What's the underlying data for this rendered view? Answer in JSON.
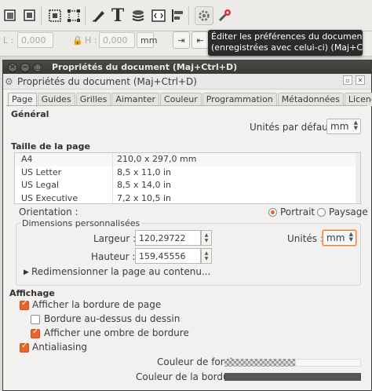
{
  "tooltip": {
    "line1": "Éditer les préférences du document",
    "line2": "(enregistrées avec celui-ci) (Maj+Ctrl+D)"
  },
  "toolbar2": {
    "l_label": "L :",
    "l_value": "0,000",
    "h_label": "H :",
    "h_value": "0,000",
    "unit": "mm"
  },
  "window": {
    "title": "Propriétés du document (Maj+Ctrl+D)",
    "panel_title": "Propriétés du document (Maj+Ctrl+D)"
  },
  "tabs": [
    "Page",
    "Guides",
    "Grilles",
    "Aimanter",
    "Couleur",
    "Programmation",
    "Métadonnées",
    "Licence"
  ],
  "general": {
    "title": "Général",
    "default_units_label": "Unités par défaut :",
    "default_units_value": "mm"
  },
  "page_size": {
    "title": "Taille de la page",
    "rows": [
      {
        "name": "A4",
        "size": "210,0 x 297,0 mm"
      },
      {
        "name": "US Letter",
        "size": "8,5 x 11,0 in"
      },
      {
        "name": "US Legal",
        "size": "8,5 x 14,0 in"
      },
      {
        "name": "US Executive",
        "size": "7,2 x 10,5 in"
      }
    ],
    "orientation_label": "Orientation :",
    "portrait_label": "Portrait",
    "landscape_label": "Paysage",
    "orientation_selected": "Portrait"
  },
  "custom_size": {
    "title": "Dimensions personnalisées",
    "width_label": "Largeur :",
    "width_value": "120,29722",
    "height_label": "Hauteur :",
    "height_value": "159,45556",
    "units_label": "Unités :",
    "units_value": "mm",
    "resize_label": "Redimensionner la page au contenu..."
  },
  "display": {
    "title": "Affichage",
    "show_border_label": "Afficher la bordure de page",
    "show_border_checked": true,
    "border_on_top_label": "Bordure au-dessus du dessin",
    "border_on_top_checked": false,
    "show_shadow_label": "Afficher une ombre de bordure",
    "show_shadow_checked": true,
    "antialiasing_label": "Antialiasing",
    "antialiasing_checked": true,
    "background_color_label": "Couleur de fond :",
    "border_color_label": "Couleur de la bordure :",
    "border_color": "#555555"
  },
  "icons": {
    "toolbar": [
      "bitmap-import-icon",
      "bitmap-export-icon",
      "align-icon",
      "transform-icon",
      "node-tool-icon",
      "text-tool-icon",
      "layers-icon",
      "xml-editor-icon",
      "align-distribute-icon",
      "document-properties-icon",
      "preferences-icon"
    ]
  }
}
